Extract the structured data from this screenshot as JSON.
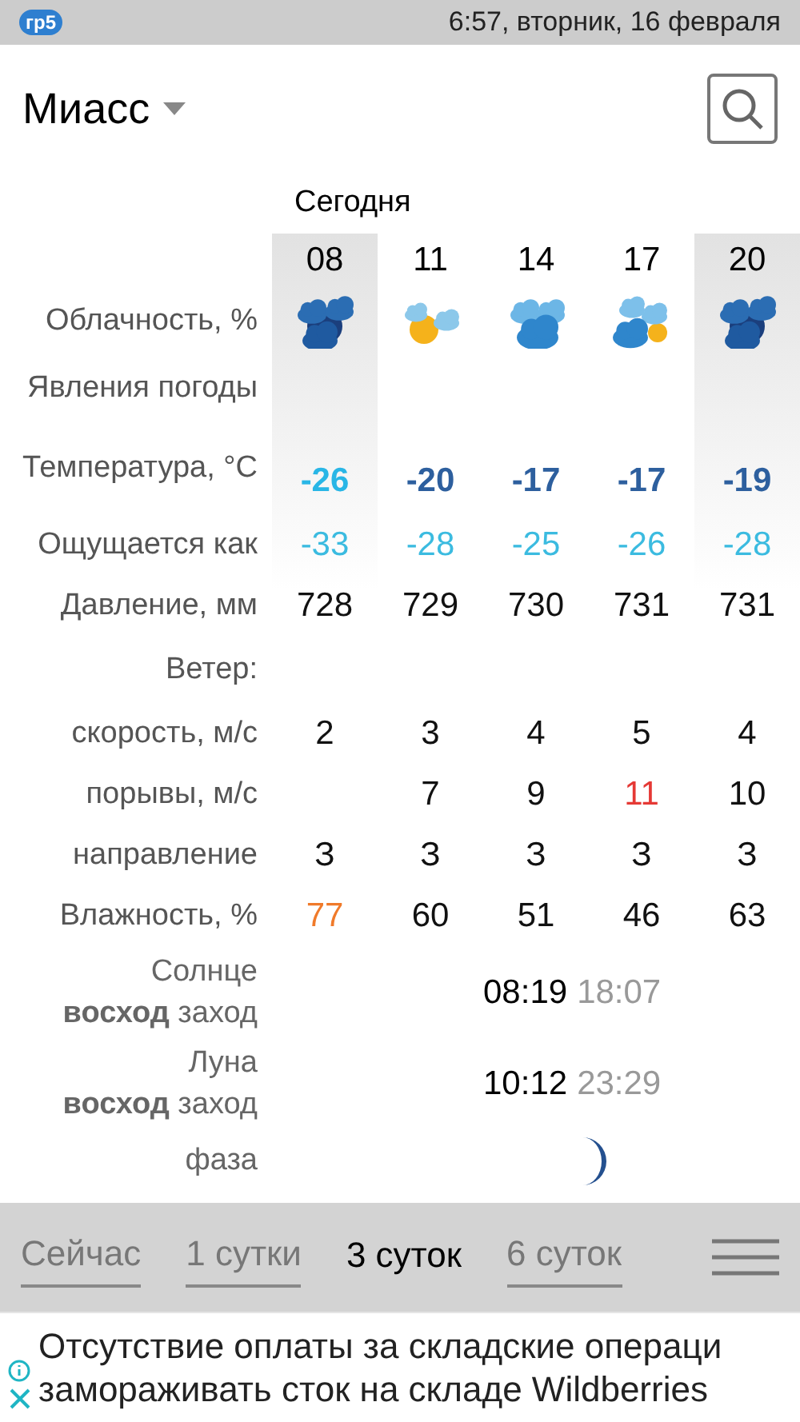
{
  "status_bar": {
    "logo": "гр5",
    "datetime": "6:57, вторник, 16 февраля"
  },
  "header": {
    "city": "Миасс"
  },
  "day_title": "Сегодня",
  "columns": [
    {
      "time": "08",
      "shaded": true,
      "kind": "cloud-moon"
    },
    {
      "time": "11",
      "shaded": false,
      "kind": "sun-cloud"
    },
    {
      "time": "14",
      "shaded": false,
      "kind": "cloud"
    },
    {
      "time": "17",
      "shaded": false,
      "kind": "cloud-sun"
    },
    {
      "time": "20",
      "shaded": true,
      "kind": "cloud-moon"
    }
  ],
  "rows": [
    {
      "kind": "icons",
      "label": "Облачность, %"
    },
    {
      "kind": "empty",
      "label": "Явления погоды"
    },
    {
      "kind": "temperature",
      "label": "Температура, °C",
      "cells": [
        {
          "text": "-26",
          "color": "#29b6e6"
        },
        {
          "text": "-20",
          "color": "#2d5f9e"
        },
        {
          "text": "-17",
          "color": "#2d5f9e"
        },
        {
          "text": "-17",
          "color": "#2d5f9e"
        },
        {
          "text": "-19",
          "color": "#2d5f9e"
        }
      ]
    },
    {
      "kind": "values",
      "label": "Ощущается как",
      "cells": [
        {
          "text": "-33",
          "color": "#3bbbe0"
        },
        {
          "text": "-28",
          "color": "#3bbbe0"
        },
        {
          "text": "-25",
          "color": "#3bbbe0"
        },
        {
          "text": "-26",
          "color": "#3bbbe0"
        },
        {
          "text": "-28",
          "color": "#3bbbe0"
        }
      ]
    },
    {
      "kind": "values",
      "label": "Давление, мм",
      "cells": [
        {
          "text": "728",
          "color": "#111111"
        },
        {
          "text": "729",
          "color": "#111111"
        },
        {
          "text": "730",
          "color": "#111111"
        },
        {
          "text": "731",
          "color": "#111111"
        },
        {
          "text": "731",
          "color": "#111111"
        }
      ]
    },
    {
      "kind": "empty",
      "label": "Ветер:"
    },
    {
      "kind": "values",
      "label": "скорость, м/с",
      "cells": [
        {
          "text": "2",
          "color": "#111111"
        },
        {
          "text": "3",
          "color": "#111111"
        },
        {
          "text": "4",
          "color": "#111111"
        },
        {
          "text": "5",
          "color": "#111111"
        },
        {
          "text": "4",
          "color": "#111111"
        }
      ]
    },
    {
      "kind": "values",
      "label": "порывы, м/с",
      "cells": [
        null,
        {
          "text": "7",
          "color": "#111111"
        },
        {
          "text": "9",
          "color": "#111111"
        },
        {
          "text": "11",
          "color": "#e53935"
        },
        {
          "text": "10",
          "color": "#111111"
        }
      ]
    },
    {
      "kind": "values",
      "label": "направление",
      "cells": [
        {
          "text": "З",
          "color": "#111111"
        },
        {
          "text": "З",
          "color": "#111111"
        },
        {
          "text": "З",
          "color": "#111111"
        },
        {
          "text": "З",
          "color": "#111111"
        },
        {
          "text": "З",
          "color": "#111111"
        }
      ]
    },
    {
      "kind": "values",
      "label": "Влажность, %",
      "cells": [
        {
          "text": "77",
          "color": "#f07a2a"
        },
        {
          "text": "60",
          "color": "#111111"
        },
        {
          "text": "51",
          "color": "#111111"
        },
        {
          "text": "46",
          "color": "#111111"
        },
        {
          "text": "63",
          "color": "#111111"
        }
      ]
    }
  ],
  "astro": [
    {
      "kind": "times",
      "title": "Солнце",
      "subtitle": "**восход** заход",
      "rise": "08:19",
      "set": "18:07"
    },
    {
      "kind": "times",
      "title": "Луна",
      "subtitle": "**восход** заход",
      "rise": "10:12",
      "set": "23:29"
    },
    {
      "kind": "phase",
      "title": "фаза"
    }
  ],
  "tabs": [
    {
      "label": "Сейчас",
      "selected": false
    },
    {
      "label": "1 сутки",
      "selected": false
    },
    {
      "label": "3 суток",
      "selected": true
    },
    {
      "label": "6 суток",
      "selected": false
    }
  ],
  "ad": {
    "lines": [
      "Отсутствие оплаты за складские операци",
      "замораживать сток на складе Wildberries"
    ]
  }
}
